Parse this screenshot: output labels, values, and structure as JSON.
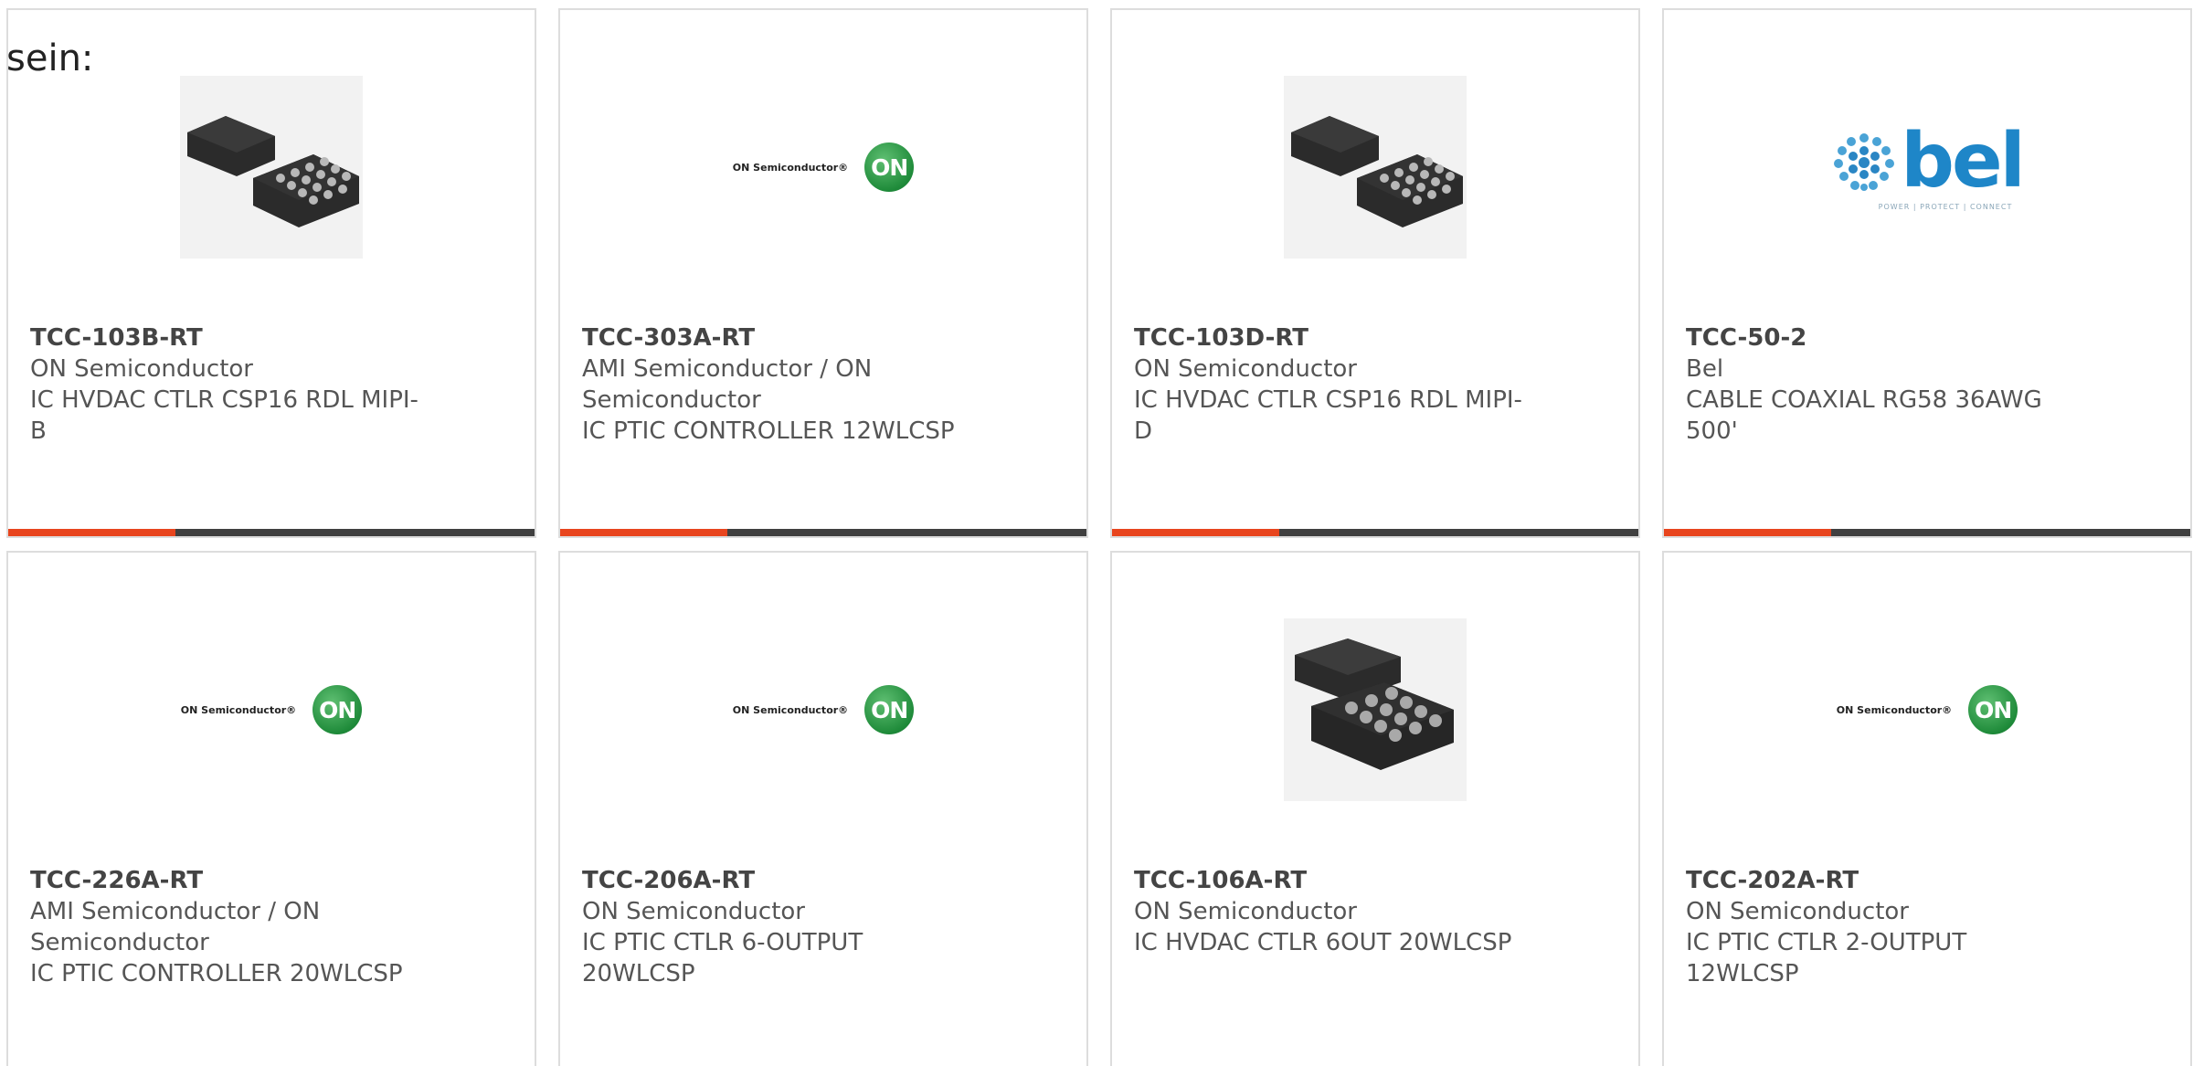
{
  "intro_text": "sein:",
  "colors": {
    "accent": "#e8451e",
    "bar_dark": "#404040",
    "card_border": "#dddddd",
    "on_semi_green": "#1f8b3a",
    "bel_blue": "#1e86c8"
  },
  "products": [
    {
      "part_number": "TCC-103B-RT",
      "manufacturer": "ON Semiconductor",
      "description": "IC HVDAC CTLR CSP16 RDL MIPI-B",
      "image": "chip-image"
    },
    {
      "part_number": "TCC-303A-RT",
      "manufacturer": "AMI Semiconductor / ON Semiconductor",
      "description": "IC PTIC CONTROLLER 12WLCSP",
      "image": "on-semiconductor-logo",
      "logo": {
        "wordmark": "ON Semiconductor®",
        "badge": "ON"
      }
    },
    {
      "part_number": "TCC-103D-RT",
      "manufacturer": "ON Semiconductor",
      "description": "IC HVDAC CTLR CSP16 RDL MIPI-D",
      "image": "chip-image"
    },
    {
      "part_number": "TCC-50-2",
      "manufacturer": "Bel",
      "description": "CABLE COAXIAL RG58 36AWG 500'",
      "image": "bel-logo",
      "logo": {
        "wordmark": "bel",
        "tagline": "POWER | PROTECT | CONNECT"
      }
    },
    {
      "part_number": "TCC-226A-RT",
      "manufacturer": "AMI Semiconductor / ON Semiconductor",
      "description": "IC PTIC CONTROLLER 20WLCSP",
      "image": "on-semiconductor-logo",
      "logo": {
        "wordmark": "ON Semiconductor®",
        "badge": "ON"
      }
    },
    {
      "part_number": "TCC-206A-RT",
      "manufacturer": "ON Semiconductor",
      "description": "IC PTIC CTLR 6-OUTPUT 20WLCSP",
      "image": "on-semiconductor-logo",
      "logo": {
        "wordmark": "ON Semiconductor®",
        "badge": "ON"
      }
    },
    {
      "part_number": "TCC-106A-RT",
      "manufacturer": "ON Semiconductor",
      "description": "IC HVDAC CTLR 6OUT 20WLCSP",
      "image": "chip-image"
    },
    {
      "part_number": "TCC-202A-RT",
      "manufacturer": "ON Semiconductor",
      "description": "IC PTIC CTLR 2-OUTPUT 12WLCSP",
      "image": "on-semiconductor-logo",
      "logo": {
        "wordmark": "ON Semiconductor®",
        "badge": "ON"
      }
    }
  ]
}
